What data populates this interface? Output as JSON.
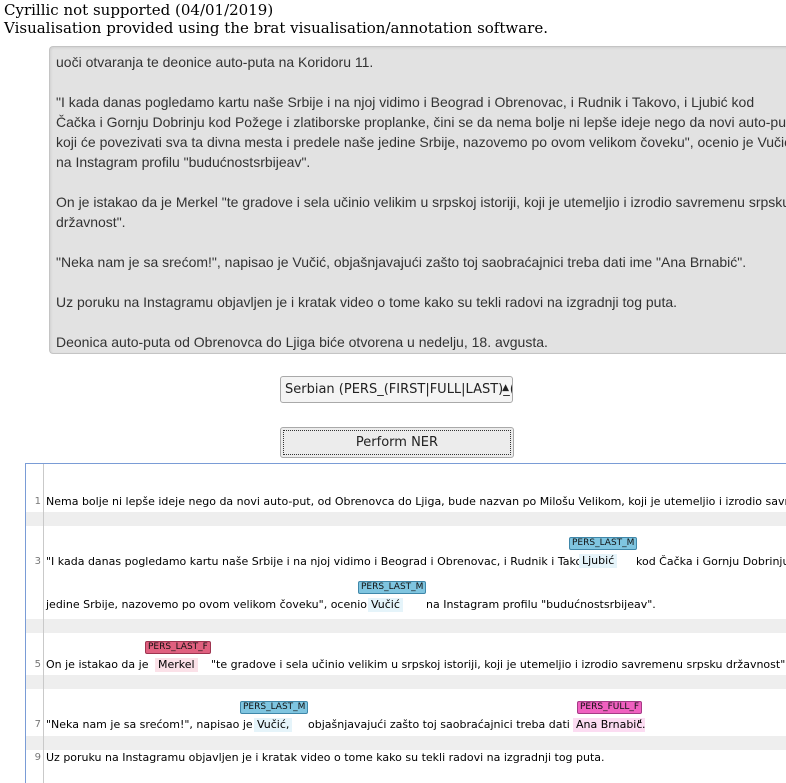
{
  "notice": {
    "line1": "Cyrillic not supported (04/01/2019)",
    "line2": "Visualisation provided using the brat visualisation/annotation software."
  },
  "input_text": {
    "paragraphs": [
      "uoči otvaranja te deonice auto-puta na Koridoru 11.",
      "\"I kada danas pogledamo kartu naše Srbije i na njoj vidimo i Beograd i Obrenovac, i Rudnik i Takovo, i Ljubić kod Čačka i Gornju Dobrinju kod Požege i zlatiborske proplanke, čini se da nema bolje ni lepše ideje nego da novi auto-put koji će povezivati sva ta divna mesta i predele naše jedine Srbije, nazovemo po ovom velikom čoveku\", ocenio je Vučić na Instagram profilu \"budućnostsrbijeav\".",
      "On je istakao da je Merkel \"te gradove i sela učinio velikim u srpskoj istoriji, koji je utemeljio i izrodio savremenu srpsku državnost\".",
      "\"Neka nam je sa srećom!\", napisao je Vučić, objašnjavajući zašto toj saobraćajnici treba dati ime \"Ana Brnabić\".",
      "Uz poruku na Instagramu objavljen je i kratak video o tome kako su tekli radovi na izgradnji tog puta.",
      "Deonica auto-puta od Obrenovca do Ljiga biće otvorena u nedelju, 18. avgusta."
    ]
  },
  "model_select": {
    "selected": "Serbian (PERS_(FIRST|FULL|LAST)_(M"
  },
  "ner_button": {
    "label": "Perform NER"
  },
  "brat": {
    "rows": [
      {
        "num": "1",
        "text": "Nema bolje ni lepše ideje nego da novi auto-put, od Obrenovca do Ljiga, bude nazvan po Milošu Velikom, koji je utemeljio i izrodio savremenu srps"
      },
      {
        "num": "3",
        "pre": "\"I kada danas pogledamo kartu naše Srbije i na njoj vidimo i Beograd i Obrenovac, i Rudnik i Takovo, i",
        "post": "kod Čačka i Gornju Dobrinju k"
      },
      {
        "text_pre": "jedine Srbije, nazovemo po ovom velikom čoveku\", ocenio je",
        "text_post": "na Instagram profilu \"budućnostsrbijeav\"."
      },
      {
        "num": "5",
        "pre": "On je istakao da je",
        "post": "\"te gradove i sela učinio velikim u srpskoj istoriji, koji je utemeljio i izrodio savremenu srpsku državnost\"."
      },
      {
        "num": "7",
        "pre": "\"Neka nam je sa srećom!\", napisao je",
        "mid": "objašnjavajući zašto toj saobraćajnici treba dati ime \"",
        "post": "\"."
      },
      {
        "num": "9",
        "text": "Uz poruku na Instagramu objavljen je i kratak video o tome kako su tekli radovi na izgradnji tog puta."
      }
    ],
    "entities": [
      {
        "label": "PERS_LAST_M",
        "text": "Ljubić",
        "color": "#7fc5e0"
      },
      {
        "label": "PERS_LAST_M",
        "text": "Vučić",
        "color": "#7fc5e0"
      },
      {
        "label": "PERS_LAST_F",
        "text": "Merkel",
        "color": "#e0607f"
      },
      {
        "label": "PERS_LAST_M",
        "text": "Vučić,",
        "color": "#7fc5e0"
      },
      {
        "label": "PERS_FULL_F",
        "text": "Ana Brnabić",
        "color": "#f060c0"
      }
    ]
  }
}
